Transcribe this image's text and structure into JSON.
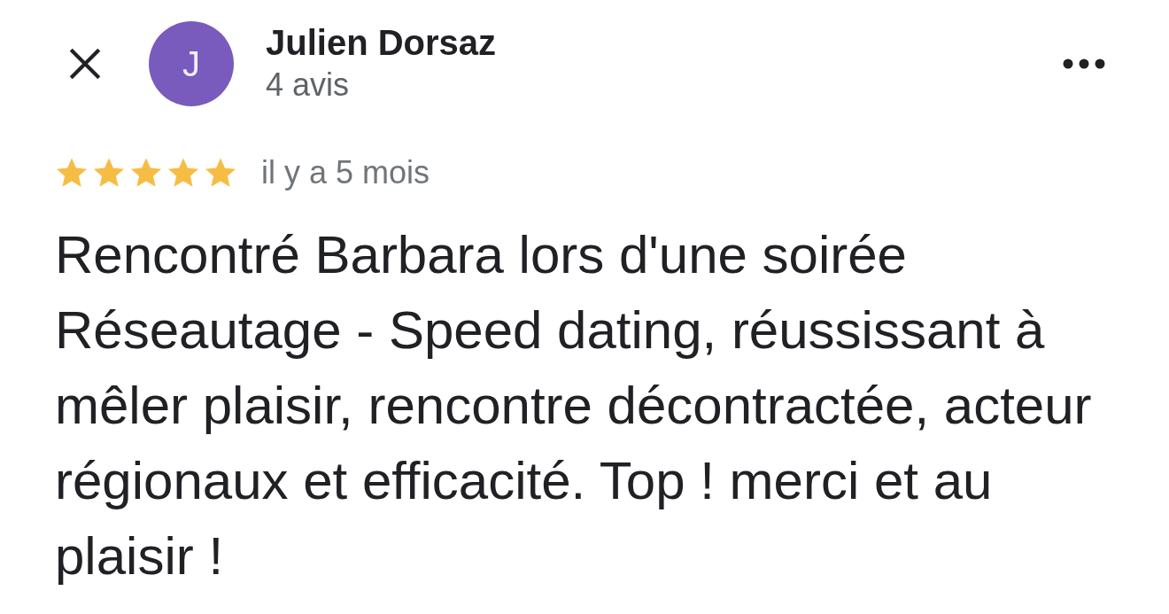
{
  "reviewer": {
    "initial": "J",
    "name": "Julien Dorsaz",
    "review_count": "4 avis"
  },
  "review": {
    "stars": 5,
    "time": "il y a 5 mois",
    "text": "Rencontré Barbara lors d'une soirée Réseautage - Speed dating, réussissant à mêler plaisir, rencontre décontractée, acteur régionaux et efficacité. Top ! merci et au plaisir !"
  }
}
